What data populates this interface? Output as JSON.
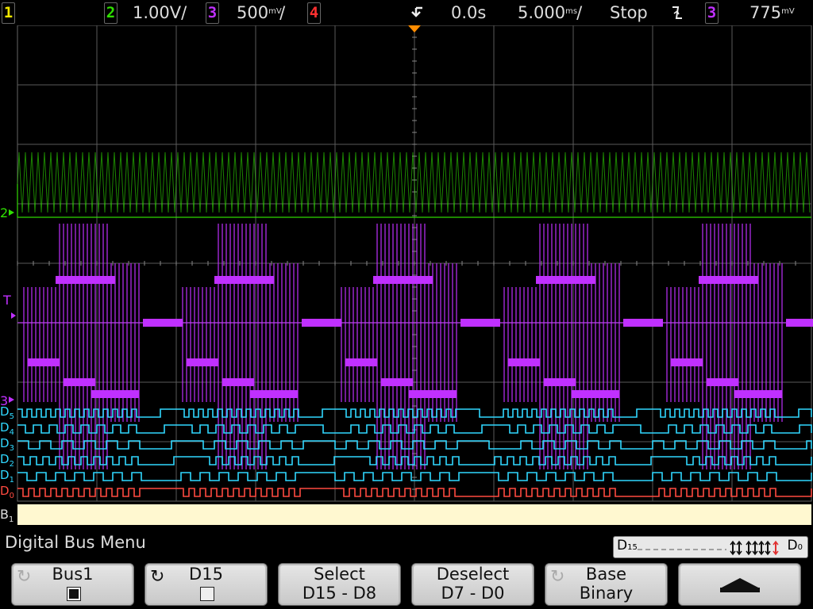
{
  "topbar": {
    "ch1_num": "1",
    "ch2_num": "2",
    "ch2_scale": "1.00V/",
    "ch3_num": "3",
    "ch3_scale": "500",
    "ch3_unit": "mV",
    "ch4_num": "4",
    "trigger_icon": "trigger-position-icon",
    "time_delay": "0.0s",
    "time_base": "5.000",
    "time_unit": "ms",
    "time_suffix": "/",
    "ch3_suffix": "/",
    "run_state": "Stop",
    "edge_icon": "falling-edge-icon",
    "trig_ch_num": "3",
    "trig_level": "775",
    "trig_level_unit": "mV"
  },
  "labels": {
    "ch2_marker": "2",
    "trig_marker": "T",
    "ch3_marker": "3",
    "digital": [
      {
        "name": "D",
        "sub": "5"
      },
      {
        "name": "D",
        "sub": "4"
      },
      {
        "name": "D",
        "sub": "3"
      },
      {
        "name": "D",
        "sub": "2"
      },
      {
        "name": "D",
        "sub": "1"
      },
      {
        "name": "D",
        "sub": "0"
      }
    ],
    "bus": {
      "name": "B",
      "sub": "1"
    }
  },
  "menu": {
    "title": "Digital Bus Menu",
    "selector_left": "D",
    "selector_left_sub": "15",
    "selector_right": "D",
    "selector_right_sub": "0"
  },
  "softkeys": [
    {
      "l1": "Bus1",
      "l2": ""
    },
    {
      "l1": "D15",
      "l2": ""
    },
    {
      "l1": "Select",
      "l2": "D15 - D8"
    },
    {
      "l1": "Deselect",
      "l2": "D7 - D0"
    },
    {
      "l1": "Base",
      "l2": "Binary"
    },
    {
      "l1": "",
      "l2": ""
    }
  ],
  "colors": {
    "ch1": "#f2e700",
    "ch2": "#2fe000",
    "ch3": "#c030ff",
    "ch4": "#ff3030",
    "digital": "#30d8ff",
    "d0": "#ff4a40",
    "trigger": "#ff8c00",
    "bus": "#fff8d0",
    "grid": "#5a5a5a"
  }
}
